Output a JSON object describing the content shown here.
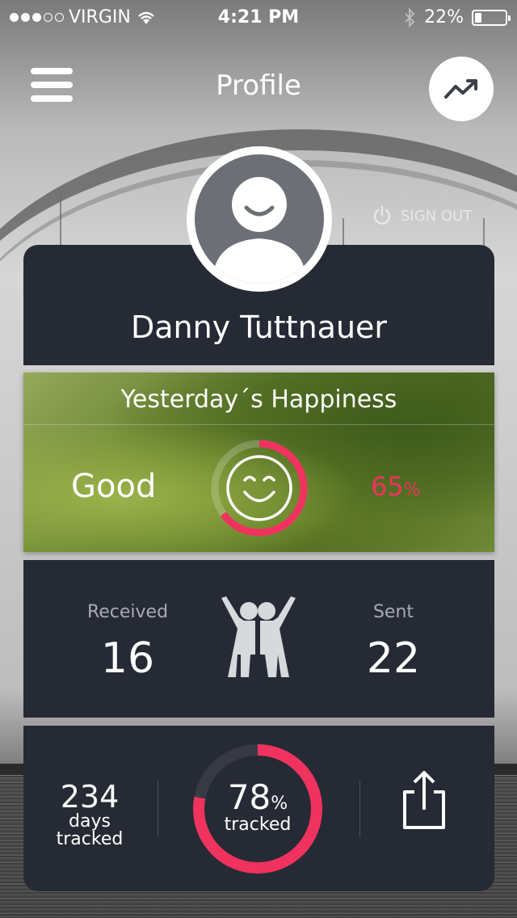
{
  "status_bar": {
    "carrier": "VIRGIN",
    "time": "4:21 PM",
    "battery": "22%"
  },
  "nav": {
    "title": "Profile",
    "menu_icon": "hamburger-icon",
    "trend_icon": "trending-up-icon"
  },
  "sign_out": {
    "label": "SIGN OUT",
    "icon": "power-icon"
  },
  "profile": {
    "name": "Danny Tuttnauer",
    "avatar_icon": "user-avatar-icon"
  },
  "happiness": {
    "title": "Yesterday´s Happiness",
    "mood": "Good",
    "percent_value": "65",
    "percent_unit": "%",
    "fraction": 0.65,
    "icon": "smiley-face-icon"
  },
  "exchange": {
    "received_label": "Received",
    "received_value": "16",
    "sent_label": "Sent",
    "sent_value": "22",
    "icon": "friends-hugging-icon"
  },
  "stats": {
    "days_value": "234",
    "days_label_1": "days",
    "days_label_2": "tracked",
    "tracked_value": "78",
    "tracked_unit": "%",
    "tracked_label": "tracked",
    "tracked_fraction": 0.78,
    "share_icon": "share-icon"
  },
  "colors": {
    "accent": "#f0325e",
    "card": "#262a34"
  }
}
